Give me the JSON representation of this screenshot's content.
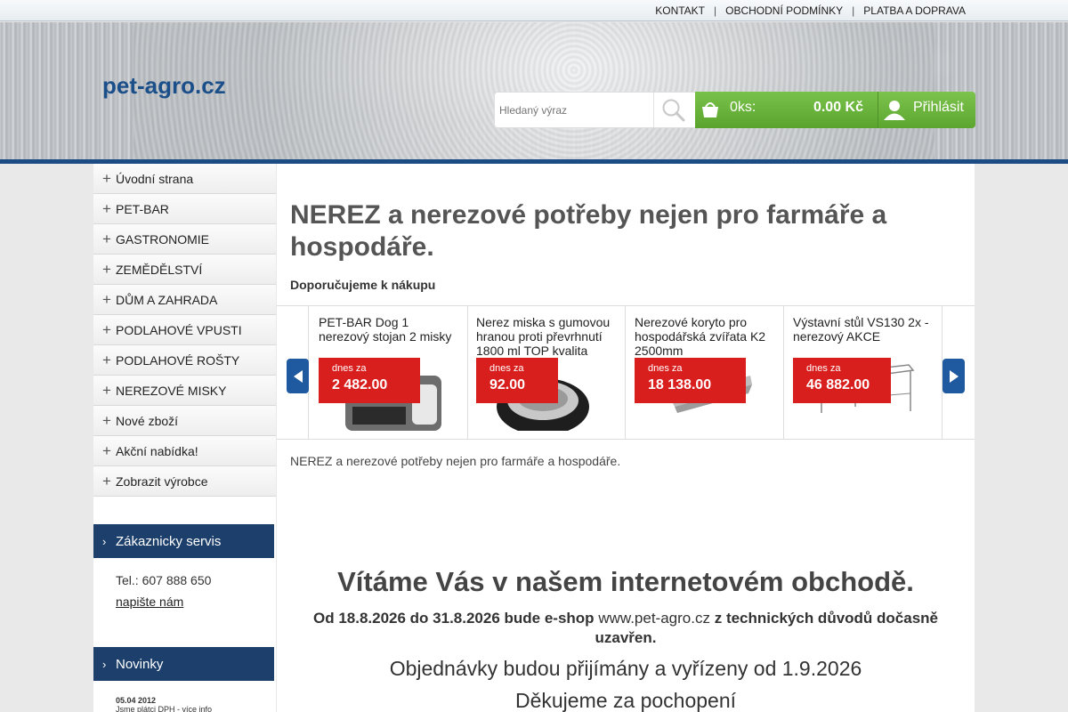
{
  "topnav": {
    "items": [
      "KONTAKT",
      "OBCHODNÍ PODMÍNKY",
      "PLATBA A DOPRAVA"
    ]
  },
  "header": {
    "logo": "pet-agro.cz",
    "search_placeholder": "Hledaný výraz",
    "cart_count": "0ks:",
    "cart_price": "0.00 Kč",
    "login_label": "Přihlásit"
  },
  "menu": {
    "items": [
      "Úvodní strana",
      "PET-BAR",
      "GASTRONOMIE",
      "ZEMĚDĚLSTVÍ",
      "DŮM A ZAHRADA",
      "PODLAHOVÉ VPUSTI",
      "PODLAHOVÉ ROŠTY",
      "NEREZOVÉ MISKY",
      "Nové zboží",
      "Akční nabídka!",
      "Zobrazit výrobce"
    ]
  },
  "servis": {
    "heading": "Zákaznicky servis",
    "phone": "Tel.: 607 888 650",
    "write_link": "napište nám"
  },
  "news": {
    "heading": "Novinky",
    "date": "05.04 2012",
    "text": "Jsme plátci DPH - více info"
  },
  "main": {
    "title": "NEREZ a nerezové potřeby nejen pro farmáře a hospodáře.",
    "recommend": "Doporučujeme k nákupu",
    "intro": "NEREZ a nerezové potřeby nejen pro farmáře a hospodáře.",
    "welcome": "Vítáme Vás v našem internetovém obchodě.",
    "closure_part1": "Od 18.8.2026 do 31.8.2026 bude e-shop",
    "closure_url": "www.pet-agro.cz",
    "closure_part2": "z technických důvodů dočasně uzavřen.",
    "orders": "Objednávky budou přijímány a vyřízeny od 1.9.2026",
    "thanks": "Děkujeme za pochopení"
  },
  "products": [
    {
      "name": "PET-BAR Dog 1 nerezový stojan 2 misky",
      "price_label": "dnes za",
      "price": "2 482.00"
    },
    {
      "name": "Nerez miska s gumovou hranou proti převrhnutí 1800 ml TOP kvalita",
      "price_label": "dnes za",
      "price": "92.00"
    },
    {
      "name": "Nerezové koryto pro hospodářská zvířata K2 2500mm",
      "price_label": "dnes za",
      "price": "18 138.00"
    },
    {
      "name": "Výstavní stůl VS130 2x - nerezový AKCE",
      "price_label": "dnes za",
      "price": "46 882.00"
    }
  ],
  "colors": {
    "brand_blue": "#1c4c84",
    "cart_green": "#6ab63c",
    "price_red": "#d91e1e"
  }
}
